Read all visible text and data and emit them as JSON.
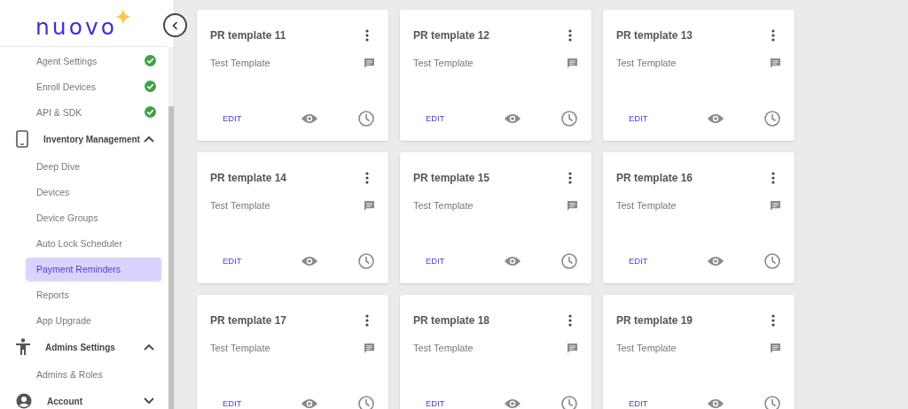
{
  "sidebar": {
    "logo": "nuovo",
    "items": [
      {
        "kind": "link",
        "label": "Agent Settings",
        "completed": true,
        "selected": false
      },
      {
        "kind": "link",
        "label": "Enroll Devices",
        "completed": true,
        "selected": false
      },
      {
        "kind": "link",
        "label": "API & SDK",
        "completed": true,
        "selected": false
      },
      {
        "kind": "section",
        "label": "Inventory Management",
        "expanded": true
      },
      {
        "kind": "link",
        "label": "Deep Dive",
        "completed": false,
        "selected": false
      },
      {
        "kind": "link",
        "label": "Devices",
        "completed": false,
        "selected": false
      },
      {
        "kind": "link",
        "label": "Device Groups",
        "completed": false,
        "selected": false
      },
      {
        "kind": "link",
        "label": "Auto Lock Scheduler",
        "completed": false,
        "selected": false
      },
      {
        "kind": "link",
        "label": "Payment Reminders",
        "completed": false,
        "selected": true
      },
      {
        "kind": "link",
        "label": "Reports",
        "completed": false,
        "selected": false
      },
      {
        "kind": "link",
        "label": "App Upgrade",
        "completed": false,
        "selected": false
      },
      {
        "kind": "section",
        "label": "Admins Settings",
        "expanded": true
      },
      {
        "kind": "link",
        "label": "Admins & Roles",
        "completed": false,
        "selected": false
      },
      {
        "kind": "section",
        "label": "Account",
        "expanded": false
      }
    ]
  },
  "cards": [
    {
      "title": "PR template 11",
      "description": "Test Template",
      "action": "EDIT"
    },
    {
      "title": "PR template 12",
      "description": "Test Template",
      "action": "EDIT"
    },
    {
      "title": "PR template 13",
      "description": "Test Template",
      "action": "EDIT"
    },
    {
      "title": "PR template 14",
      "description": "Test Template",
      "action": "EDIT"
    },
    {
      "title": "PR template 15",
      "description": "Test Template",
      "action": "EDIT"
    },
    {
      "title": "PR template 16",
      "description": "Test Template",
      "action": "EDIT"
    },
    {
      "title": "PR template 17",
      "description": "Test Template",
      "action": "EDIT"
    },
    {
      "title": "PR template 18",
      "description": "Test Template",
      "action": "EDIT"
    },
    {
      "title": "PR template 19",
      "description": "Test Template",
      "action": "EDIT"
    }
  ]
}
